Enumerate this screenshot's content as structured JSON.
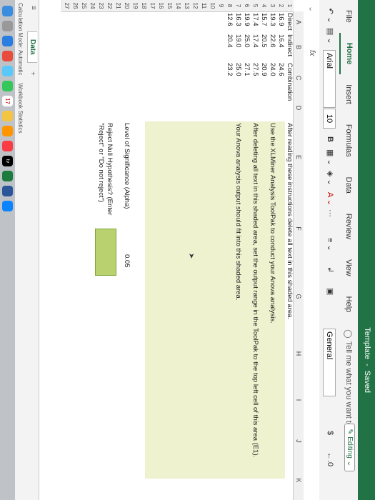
{
  "window": {
    "title": "Template",
    "saved": "Saved"
  },
  "ribbon": {
    "tabs": [
      "File",
      "Home",
      "Insert",
      "Formulas",
      "Data",
      "Review",
      "View",
      "Help"
    ],
    "tell_me": "Tell me what you want to do",
    "editing": "Editing"
  },
  "toolbar": {
    "font": "Arial",
    "size": "10",
    "bold": "B",
    "number_format": "General",
    "currency": "$"
  },
  "formula_bar": {
    "fx": "fx"
  },
  "columns": [
    "A",
    "B",
    "C",
    "D",
    "E",
    "F",
    "G",
    "H",
    "I",
    "J",
    "K"
  ],
  "table": {
    "headers": [
      "Direct",
      "Indirect",
      "Combination"
    ],
    "rows": [
      [
        "16.9",
        "16.4",
        "24.6"
      ],
      [
        "19.3",
        "22.6",
        "24.0"
      ],
      [
        "15.7",
        "20.5",
        "20.9"
      ],
      [
        "17.4",
        "17.4",
        "27.5"
      ],
      [
        "19.9",
        "25.0",
        "27.1"
      ],
      [
        "16.3",
        "19.0",
        "25.0"
      ],
      [
        "12.6",
        "20.4",
        "23.2"
      ]
    ]
  },
  "instructions": [
    "After reading these instructions delete all text in this shaded area.",
    "Use the XLMiner Analysis ToolPak to conduct your Anova analysis.",
    "After deleting all text in this shaded area, set the output range in the ToolPak to the top left cell of this area (E1).",
    "Your Anova analysis output should fit into this shaded area."
  ],
  "significance": {
    "label": "Level of Significance (Alpha)",
    "value": "0.05"
  },
  "reject": {
    "line1": "Reject Null Hypothesis? (Enter",
    "line2": "\"Reject\" or \"Do not reject\")"
  },
  "sheet_tab": "Data",
  "status": {
    "calc": "Calculation Mode: Automatic",
    "stats": "Workbook Statistics"
  },
  "dock": {
    "badge": "17",
    "tv": "tv"
  }
}
